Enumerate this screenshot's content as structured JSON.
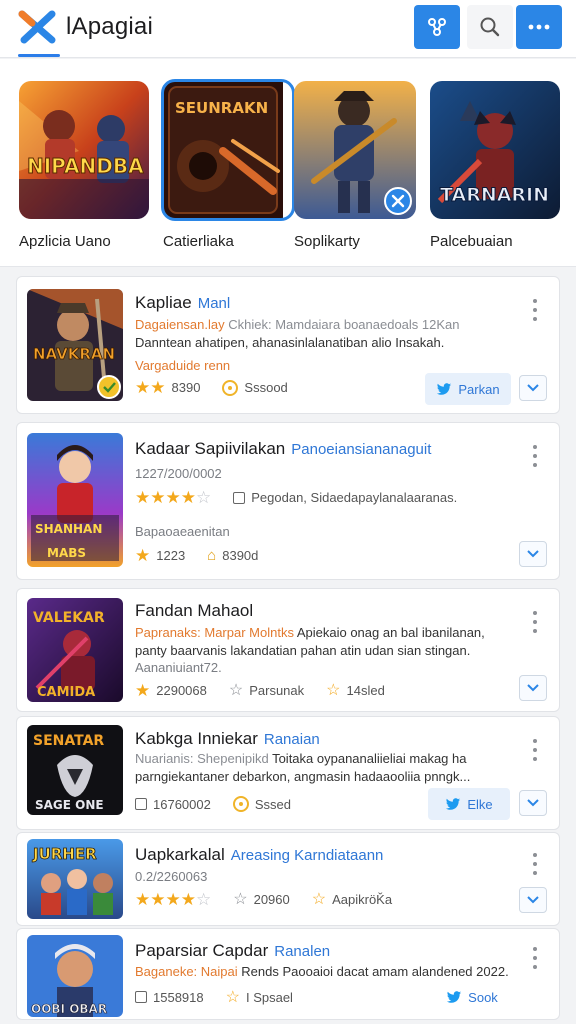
{
  "header": {
    "title": "lApagiai"
  },
  "featured": [
    {
      "label": "Apzlicia Uano",
      "art": "NIPANDBA"
    },
    {
      "label": "Catierliaka",
      "art": "SEUNRAKN"
    },
    {
      "label": "Soplikarty",
      "art": ""
    },
    {
      "label": "Palcebuaian",
      "art": "TARNARIN"
    }
  ],
  "cards": [
    {
      "title": "Kapliae",
      "accent": "Manl",
      "line1_orange": "Dagaiensan.lay",
      "line1_rest": "  Ckhiek: Mamdaiara boanaedoals 12Kan",
      "line2": "Danntean ahatipen, ahanasinlalanatiban alio Insakah.",
      "sub": "Vargaduide renn",
      "rating": "8390",
      "stat2": "Sssood",
      "share_label": "Parkan",
      "thumb_art": "NAVKRAN"
    },
    {
      "title": "Kadaar Sapiivilakan",
      "accent": "Panoeiansiananaguit",
      "line1": "1227/200/0002",
      "line2_rest": "Pegodan,  Sidaedapaylanalaaranas.",
      "sub": "Bapaoaeaenitan",
      "rating": "1223",
      "stat2": "8390d",
      "thumb_art": "SHANHAN"
    },
    {
      "title": "Fandan Mahaol",
      "line1_orange": "Papranaks: Marpar Molntks",
      "line1_rest": " Apiekaio onag an bal ibanilanan,",
      "line2": "panty baarvanis lakandatian pahan atin udan sian stingan.",
      "sub": "Aananiuiant72.",
      "rating": "2290068",
      "stat2": "Parsunak",
      "stat3": "14sled",
      "thumb_art": "VALEKAR"
    },
    {
      "title": "Kabkga Inniekar",
      "accent": "Ranaian",
      "line1_orange": "Nuarianis: Shepenipikd",
      "line1_rest": "   Toitaka oypananaliieliai makag  ha",
      "line2": "parngiekantaner debarkon, angmasin hadaaooliia pnngk...",
      "rating": "16760002",
      "stat2": "Sssed",
      "share_label": "Elke",
      "thumb_art": "SENATAR"
    },
    {
      "title": "Uapkarkalal",
      "accent": "Areasing Karndiataann",
      "line1": "0.2/2260063",
      "rating": "20960",
      "stat3": "AapikröǨa",
      "thumb_art": "JURHER"
    },
    {
      "title": "Paparsiar Capdar",
      "accent": "Ranalen",
      "line1_orange": "Baganeke: Naipai",
      "line1_rest": "Rends Paooaioi dacat amam alandened 2022.",
      "rating": "1558918",
      "stat2": "I Spsael",
      "share_label": "Sook",
      "thumb_art": "OOBI OBAR"
    }
  ],
  "colors": {
    "accent": "#2b86e6",
    "star": "#f3a81c",
    "orange_text": "#e27a2f"
  }
}
